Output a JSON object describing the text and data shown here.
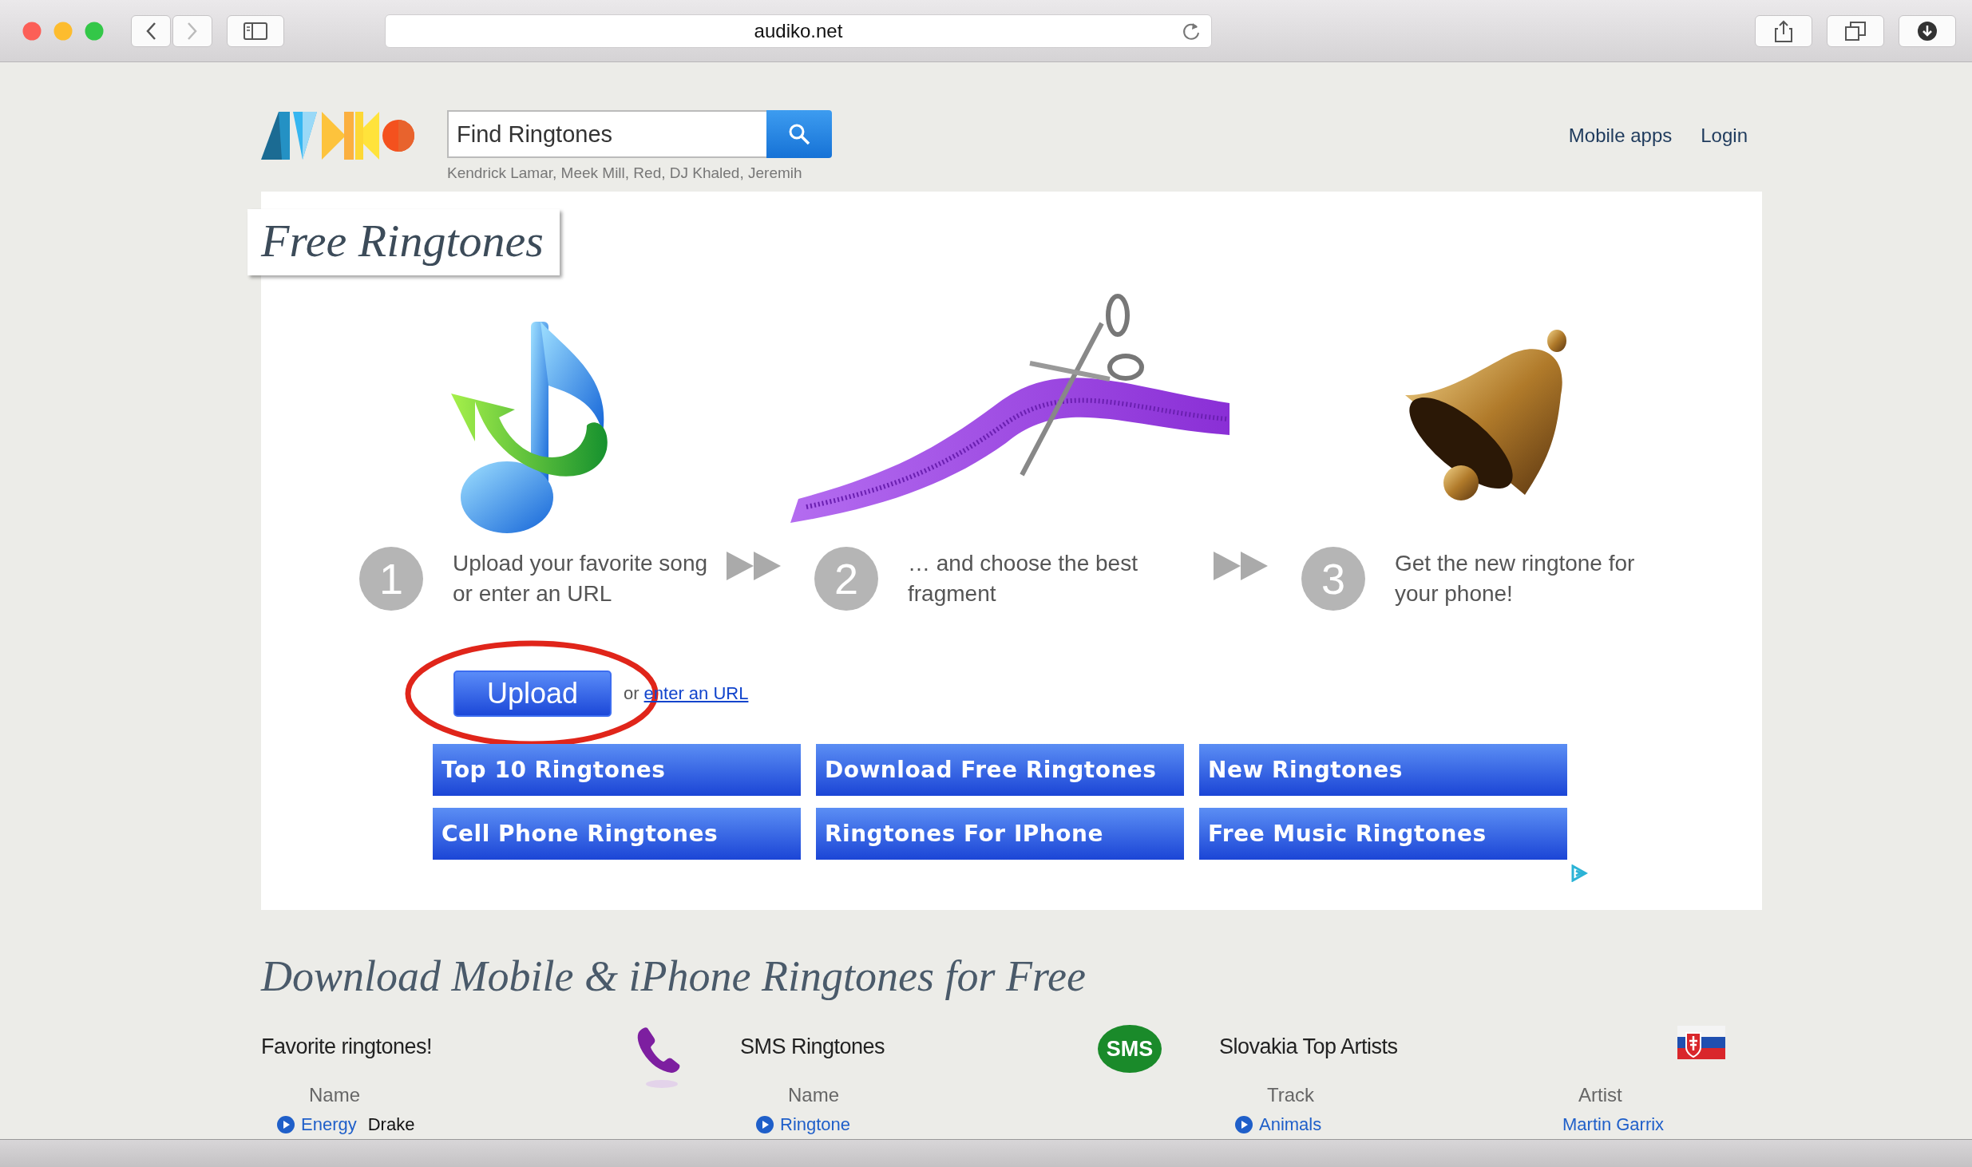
{
  "browser": {
    "url": "audiko.net"
  },
  "header": {
    "search": {
      "placeholder": "Find Ringtones"
    },
    "hint": "Kendrick Lamar, Meek Mill, Red, DJ Khaled, Jeremih",
    "nav": [
      "Mobile apps",
      "Login"
    ]
  },
  "hero": {
    "title": "Free Ringtones",
    "steps": [
      {
        "number": "1",
        "text": "Upload your favorite song or enter an URL",
        "kind": "upload"
      },
      {
        "number": "2",
        "text": "… and choose the best fragment",
        "kind": "cut"
      },
      {
        "number": "3",
        "text": "Get the new ringtone for your phone!",
        "kind": "bell"
      }
    ],
    "upload_button": "Upload",
    "url_prefix": "or",
    "url_link": "enter an URL",
    "links": [
      "Top 10 Ringtones",
      "Download Free Ringtones",
      "New Ringtones",
      "Cell Phone Ringtones",
      "Ringtones For IPhone",
      "Free Music Ringtones"
    ]
  },
  "section": {
    "title": "Download Mobile & iPhone Ringtones for Free",
    "columns": [
      {
        "title": "Favorite ringtones!",
        "kind": "phone",
        "headers": [
          "Name"
        ],
        "rows": [
          {
            "track": "Energy",
            "artist": "Drake",
            "artist_link": false
          }
        ]
      },
      {
        "title": "SMS Ringtones",
        "kind": "sms",
        "badge": "SMS",
        "headers": [
          "Name"
        ],
        "rows": [
          {
            "track": "Ringtone"
          }
        ]
      },
      {
        "title": "Slovakia Top Artists",
        "kind": "flag",
        "headers": [
          "Track",
          "Artist"
        ],
        "rows": [
          {
            "track": "Animals",
            "artist": "Martin Garrix",
            "artist_link": true
          }
        ]
      }
    ]
  }
}
